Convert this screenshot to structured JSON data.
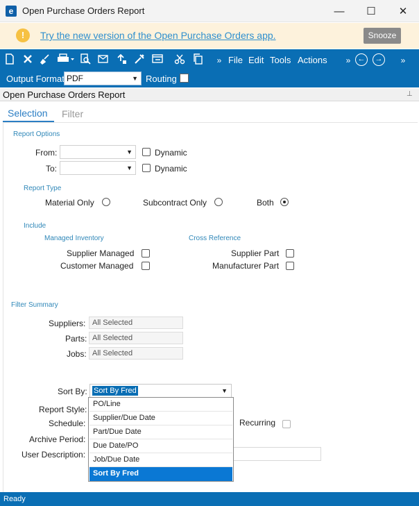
{
  "window": {
    "title": "Open Purchase Orders Report",
    "logo_letter": "e",
    "controls": {
      "minimize": "—",
      "maximize": "☐",
      "close": "✕"
    }
  },
  "banner": {
    "icon": "!",
    "link_text": "Try the new version of the Open Purchase Orders app.",
    "snooze_label": "Snooze"
  },
  "toolbar": {
    "icons": [
      "new-icon",
      "delete-icon",
      "clear-icon",
      "print-icon",
      "print-preview-icon",
      "send-icon",
      "attach-icon",
      "tools-icon",
      "layout-icon",
      "cut-icon",
      "copy-icon"
    ],
    "more_glyph": "»",
    "menus": {
      "file": "File",
      "edit": "Edit",
      "tools": "Tools",
      "actions": "Actions"
    },
    "nav": {
      "back": "←",
      "forward": "→"
    },
    "output_format_label": "Output Format:",
    "output_format_value": "PDF",
    "routing_label": "Routing"
  },
  "panel": {
    "title": "Open Purchase Orders Report",
    "pin": "⊥"
  },
  "tabs": {
    "selection": "Selection",
    "filter": "Filter"
  },
  "report_options": {
    "section": "Report Options",
    "from_label": "From:",
    "to_label": "To:",
    "dynamic_label": "Dynamic"
  },
  "report_type": {
    "section": "Report Type",
    "material_only": "Material Only",
    "subcontract_only": "Subcontract Only",
    "both": "Both",
    "selected": "Both"
  },
  "include": {
    "section": "Include",
    "managed_inventory": "Managed Inventory",
    "supplier_managed": "Supplier Managed",
    "customer_managed": "Customer Managed",
    "cross_reference": "Cross Reference",
    "supplier_part": "Supplier Part",
    "manufacturer_part": "Manufacturer Part"
  },
  "filter_summary": {
    "section": "Filter Summary",
    "suppliers_label": "Suppliers:",
    "suppliers_value": "All Selected",
    "parts_label": "Parts:",
    "parts_value": "All Selected",
    "jobs_label": "Jobs:",
    "jobs_value": "All Selected"
  },
  "options": {
    "sort_by_label": "Sort By:",
    "sort_by_value": "Sort By Fred",
    "sort_by_options": [
      "PO/Line",
      "Supplier/Due Date",
      "Part/Due Date",
      "Due Date/PO",
      "Job/Due Date",
      "Sort By Fred"
    ],
    "report_style_label": "Report Style:",
    "schedule_label": "Schedule:",
    "recurring_label": "Recurring",
    "archive_period_label": "Archive Period:",
    "user_description_label": "User Description:"
  },
  "status": {
    "text": "Ready"
  }
}
